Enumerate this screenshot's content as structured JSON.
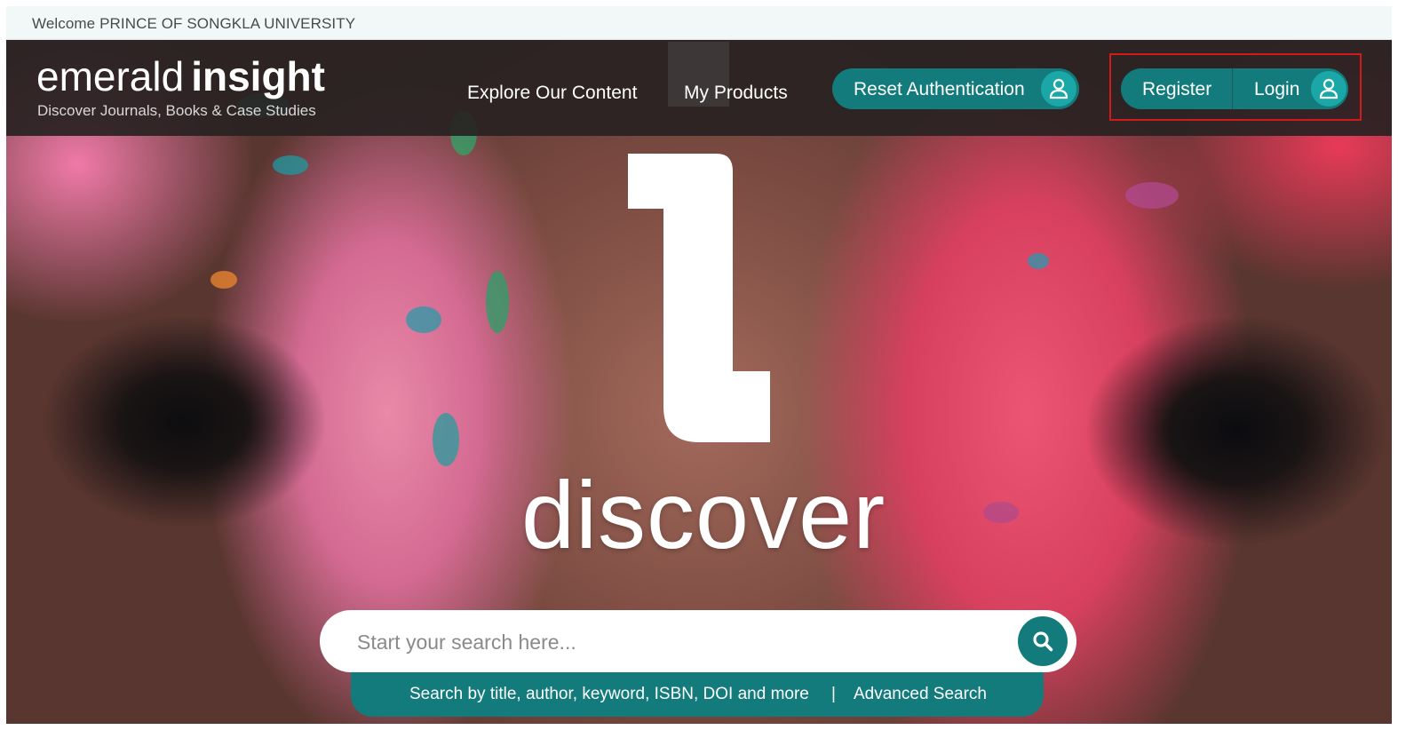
{
  "welcome": {
    "text": "Welcome PRINCE OF SONGKLA UNIVERSITY"
  },
  "header": {
    "logo_light": "emerald",
    "logo_bold": "insight",
    "tagline": "Discover Journals, Books & Case Studies",
    "nav": [
      {
        "label": "Explore Our Content"
      },
      {
        "label": "My Products"
      }
    ],
    "reset_auth_label": "Reset Authentication",
    "register_label": "Register",
    "login_label": "Login"
  },
  "hero": {
    "headline": "discover"
  },
  "search": {
    "placeholder": "Start your search here...",
    "hint": "Search by title, author, keyword, ISBN, DOI and more",
    "separator": "|",
    "advanced_label": "Advanced Search"
  },
  "colors": {
    "brand_teal": "#137b7c",
    "accent_teal_light": "#1ba7a8",
    "header_bg": "#282222",
    "highlight_red": "#d31a1a"
  },
  "icons": {
    "user": "user-icon",
    "search": "search-icon"
  }
}
